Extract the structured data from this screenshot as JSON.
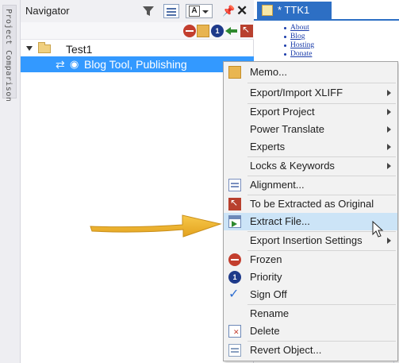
{
  "side_tab": {
    "label": "Project Comparison"
  },
  "navigator": {
    "title": "Navigator",
    "font_button_label": "A",
    "pin_glyph": "📌",
    "close_glyph": "✕",
    "toolbar_priority_label": "1",
    "tree": [
      {
        "label": "Test1",
        "expanded": true
      },
      {
        "label": "Blog Tool, Publishing",
        "selected": true
      }
    ]
  },
  "document_tab": {
    "label": "* TTK1",
    "links": [
      "About",
      "Blog",
      "Hosting",
      "Donate"
    ]
  },
  "context_menu": {
    "items": [
      {
        "label": "Memo...",
        "icon": "memo-icon",
        "submenu": false
      },
      {
        "label": "Export/Import XLIFF",
        "icon": "",
        "submenu": true
      },
      {
        "label": "Export Project",
        "icon": "",
        "submenu": true
      },
      {
        "label": "Power Translate",
        "icon": "",
        "submenu": true
      },
      {
        "label": "Experts",
        "icon": "",
        "submenu": true
      },
      {
        "label": "Locks & Keywords",
        "icon": "",
        "submenu": true
      },
      {
        "label": "Alignment...",
        "icon": "alignment-icon",
        "submenu": false
      },
      {
        "label": "To be Extracted as Original",
        "icon": "extract-original-icon",
        "submenu": false
      },
      {
        "label": "Extract File...",
        "icon": "extract-file-icon",
        "submenu": false,
        "highlighted": true
      },
      {
        "label": "Export Insertion Settings",
        "icon": "",
        "submenu": true
      },
      {
        "label": "Frozen",
        "icon": "frozen-icon",
        "submenu": false
      },
      {
        "label": "Priority",
        "icon": "priority-icon",
        "submenu": false,
        "icon_text": "1"
      },
      {
        "label": "Sign Off",
        "icon": "checkmark-icon",
        "submenu": false
      },
      {
        "label": "Rename",
        "icon": "",
        "submenu": false
      },
      {
        "label": "Delete",
        "icon": "delete-icon",
        "submenu": false
      },
      {
        "label": "Revert Object...",
        "icon": "revert-icon",
        "submenu": false
      }
    ]
  },
  "colors": {
    "selection": "#3399ff",
    "menu_highlight": "#cce4f7",
    "arrow": "#f0b429",
    "tab_accent": "#2d6fc4"
  }
}
